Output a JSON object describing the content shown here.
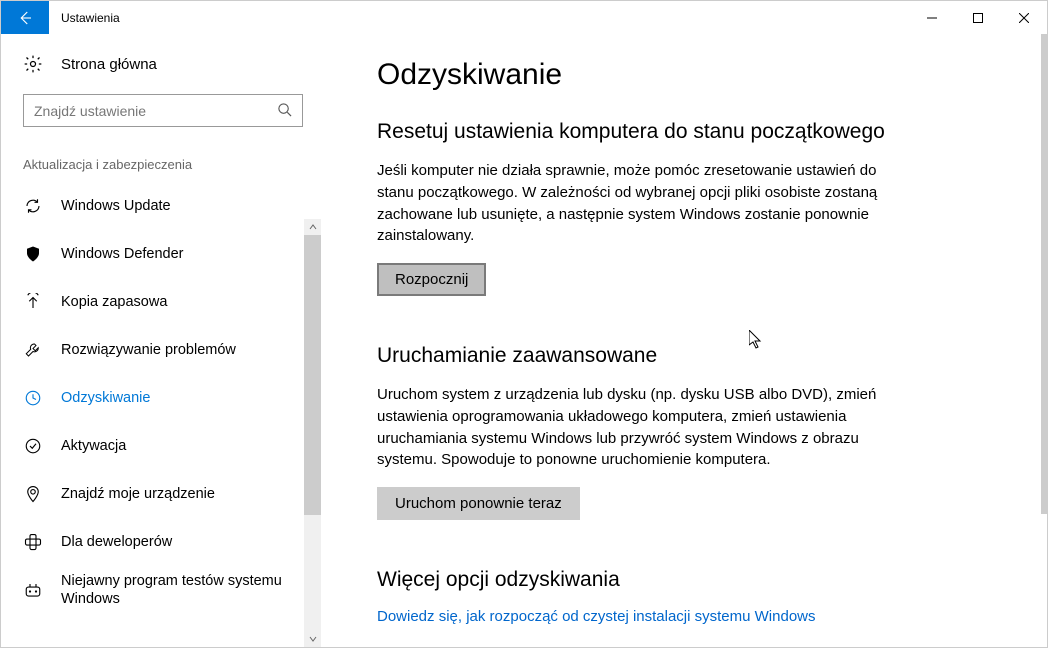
{
  "window": {
    "title": "Ustawienia"
  },
  "sidebar": {
    "home": "Strona główna",
    "search_placeholder": "Znajdź ustawienie",
    "category": "Aktualizacja i zabezpieczenia",
    "items": [
      {
        "label": "Windows Update",
        "icon": "sync-icon"
      },
      {
        "label": "Windows Defender",
        "icon": "shield-icon"
      },
      {
        "label": "Kopia zapasowa",
        "icon": "backup-icon"
      },
      {
        "label": "Rozwiązywanie problemów",
        "icon": "troubleshoot-icon"
      },
      {
        "label": "Odzyskiwanie",
        "icon": "recovery-icon",
        "selected": true
      },
      {
        "label": "Aktywacja",
        "icon": "activation-icon"
      },
      {
        "label": "Znajdź moje urządzenie",
        "icon": "find-device-icon"
      },
      {
        "label": "Dla deweloperów",
        "icon": "developer-icon"
      },
      {
        "label": "Niejawny program testów systemu Windows",
        "icon": "insider-icon"
      }
    ]
  },
  "main": {
    "title": "Odzyskiwanie",
    "reset": {
      "heading": "Resetuj ustawienia komputera do stanu początkowego",
      "body": "Jeśli komputer nie działa sprawnie, może pomóc zresetowanie ustawień do stanu początkowego. W zależności od wybranej opcji pliki osobiste zostaną zachowane lub usunięte, a następnie system Windows zostanie ponownie zainstalowany.",
      "button": "Rozpocznij"
    },
    "advanced": {
      "heading": "Uruchamianie zaawansowane",
      "body": "Uruchom system z urządzenia lub dysku (np. dysku USB albo DVD), zmień ustawienia oprogramowania układowego komputera, zmień ustawienia uruchamiania systemu Windows lub przywróć system Windows z obrazu systemu. Spowoduje to ponowne uruchomienie komputera.",
      "button": "Uruchom ponownie teraz"
    },
    "more": {
      "heading": "Więcej opcji odzyskiwania",
      "link": "Dowiedz się, jak rozpocząć od czystej instalacji systemu Windows"
    }
  }
}
